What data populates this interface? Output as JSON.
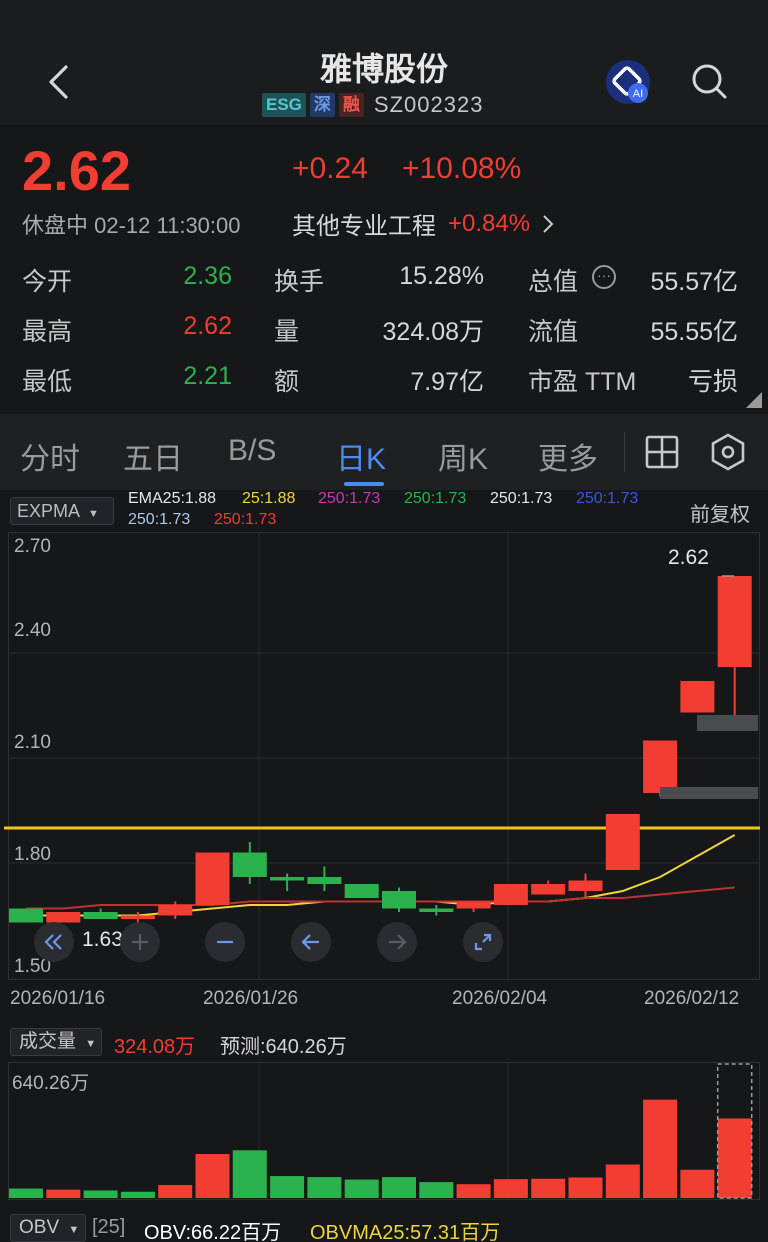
{
  "header": {
    "title": "雅博股份",
    "badges": [
      "ESG",
      "深",
      "融"
    ],
    "code": "SZ002323",
    "ai_badge": "AI"
  },
  "quote": {
    "price": "2.62",
    "change": "+0.24",
    "change_pct": "+10.08%",
    "status": "休盘中 02-12 11:30:00",
    "sector_name": "其他专业工程",
    "sector_pct": "+0.84%",
    "stats": [
      {
        "label": "今开",
        "value": "2.36",
        "color": "#2bb24c"
      },
      {
        "label": "换手",
        "value": "15.28%",
        "color": "#d6d6d6"
      },
      {
        "label": "总值",
        "value": "55.57亿",
        "color": "#d6d6d6"
      },
      {
        "label": "最高",
        "value": "2.62",
        "color": "#f23d33"
      },
      {
        "label": "量",
        "value": "324.08万",
        "color": "#d6d6d6"
      },
      {
        "label": "流值",
        "value": "55.55亿",
        "color": "#d6d6d6"
      },
      {
        "label": "最低",
        "value": "2.21",
        "color": "#2bb24c"
      },
      {
        "label": "额",
        "value": "7.97亿",
        "color": "#d6d6d6"
      },
      {
        "label": "市盈 TTM",
        "value": "亏损",
        "color": "#d6d6d6"
      }
    ]
  },
  "tabs": [
    "分时",
    "五日",
    "B/S",
    "日K",
    "周K",
    "更多"
  ],
  "indicator": {
    "selector": "EXPMA",
    "legend": [
      {
        "text": "EMA25:1.88",
        "color": "#e6e6e6"
      },
      {
        "text": "25:1.88",
        "color": "#f0d43c"
      },
      {
        "text": "250:1.73",
        "color": "#c43ab8"
      },
      {
        "text": "250:1.73",
        "color": "#2bb24c"
      },
      {
        "text": "250:1.73",
        "color": "#e6e6e6"
      },
      {
        "text": "250:1.73",
        "color": "#3d57d8"
      },
      {
        "text": "250:1.73",
        "color": "#a8c8f0"
      },
      {
        "text": "250:1.73",
        "color": "#f23d33"
      }
    ],
    "adjust": "前复权"
  },
  "chart_data": {
    "type": "candlestick",
    "y_ticks": [
      "2.70",
      "2.40",
      "2.10",
      "1.80",
      "1.50"
    ],
    "ylim": [
      1.5,
      2.7
    ],
    "x_labels": [
      "2026/01/16",
      "2026/01/26",
      "2026/02/04",
      "2026/02/12"
    ],
    "last_price_label": "2.62",
    "low_marker_label": "1.63",
    "reference_line": 1.9,
    "candles": [
      {
        "open": 1.67,
        "close": 1.63,
        "high": 1.67,
        "low": 1.63
      },
      {
        "open": 1.63,
        "close": 1.66,
        "high": 1.66,
        "low": 1.63
      },
      {
        "open": 1.66,
        "close": 1.64,
        "high": 1.67,
        "low": 1.64
      },
      {
        "open": 1.64,
        "close": 1.65,
        "high": 1.66,
        "low": 1.63
      },
      {
        "open": 1.65,
        "close": 1.68,
        "high": 1.69,
        "low": 1.64
      },
      {
        "open": 1.68,
        "close": 1.83,
        "high": 1.83,
        "low": 1.68
      },
      {
        "open": 1.83,
        "close": 1.76,
        "high": 1.86,
        "low": 1.74
      },
      {
        "open": 1.76,
        "close": 1.75,
        "high": 1.77,
        "low": 1.72
      },
      {
        "open": 1.76,
        "close": 1.74,
        "high": 1.79,
        "low": 1.72
      },
      {
        "open": 1.74,
        "close": 1.7,
        "high": 1.74,
        "low": 1.7
      },
      {
        "open": 1.72,
        "close": 1.67,
        "high": 1.73,
        "low": 1.66
      },
      {
        "open": 1.67,
        "close": 1.66,
        "high": 1.68,
        "low": 1.65
      },
      {
        "open": 1.67,
        "close": 1.69,
        "high": 1.69,
        "low": 1.66
      },
      {
        "open": 1.68,
        "close": 1.74,
        "high": 1.74,
        "low": 1.68
      },
      {
        "open": 1.71,
        "close": 1.74,
        "high": 1.75,
        "low": 1.71
      },
      {
        "open": 1.72,
        "close": 1.75,
        "high": 1.77,
        "low": 1.7
      },
      {
        "open": 1.78,
        "close": 1.94,
        "high": 1.94,
        "low": 1.78
      },
      {
        "open": 2.0,
        "close": 2.15,
        "high": 2.15,
        "low": 1.99
      },
      {
        "open": 2.23,
        "close": 2.32,
        "high": 2.32,
        "low": 2.23
      },
      {
        "open": 2.36,
        "close": 2.62,
        "high": 2.62,
        "low": 2.21
      }
    ],
    "series": [
      {
        "name": "EMA25",
        "color": "#f0d43c",
        "values": [
          1.65,
          1.65,
          1.65,
          1.65,
          1.66,
          1.67,
          1.68,
          1.68,
          1.69,
          1.69,
          1.69,
          1.69,
          1.68,
          1.69,
          1.69,
          1.7,
          1.72,
          1.76,
          1.82,
          1.88
        ]
      },
      {
        "name": "250",
        "color": "#c03030",
        "values": [
          1.67,
          1.67,
          1.68,
          1.68,
          1.68,
          1.68,
          1.69,
          1.69,
          1.69,
          1.69,
          1.69,
          1.69,
          1.69,
          1.69,
          1.69,
          1.7,
          1.7,
          1.71,
          1.72,
          1.73
        ]
      }
    ]
  },
  "volume": {
    "selector": "成交量",
    "value": "324.08万",
    "forecast": "预测:640.26万",
    "axis_max": "640.26万",
    "bars": [
      {
        "v": 45,
        "c": "#2bb24c"
      },
      {
        "v": 40,
        "c": "#f23d33"
      },
      {
        "v": 36,
        "c": "#2bb24c"
      },
      {
        "v": 30,
        "c": "#2bb24c"
      },
      {
        "v": 62,
        "c": "#f23d33"
      },
      {
        "v": 210,
        "c": "#f23d33"
      },
      {
        "v": 228,
        "c": "#2bb24c"
      },
      {
        "v": 105,
        "c": "#2bb24c"
      },
      {
        "v": 100,
        "c": "#2bb24c"
      },
      {
        "v": 88,
        "c": "#2bb24c"
      },
      {
        "v": 100,
        "c": "#2bb24c"
      },
      {
        "v": 76,
        "c": "#2bb24c"
      },
      {
        "v": 66,
        "c": "#f23d33"
      },
      {
        "v": 90,
        "c": "#f23d33"
      },
      {
        "v": 92,
        "c": "#f23d33"
      },
      {
        "v": 98,
        "c": "#f23d33"
      },
      {
        "v": 160,
        "c": "#f23d33"
      },
      {
        "v": 470,
        "c": "#f23d33"
      },
      {
        "v": 135,
        "c": "#f23d33"
      },
      {
        "v": 380,
        "c": "#f23d33"
      }
    ],
    "vmax": 640.26,
    "forecast_v": 640.26
  },
  "obv": {
    "selector": "OBV",
    "period": "[25]",
    "obv": "OBV:66.22百万",
    "obvma": "OBVMA25:57.31百万"
  }
}
